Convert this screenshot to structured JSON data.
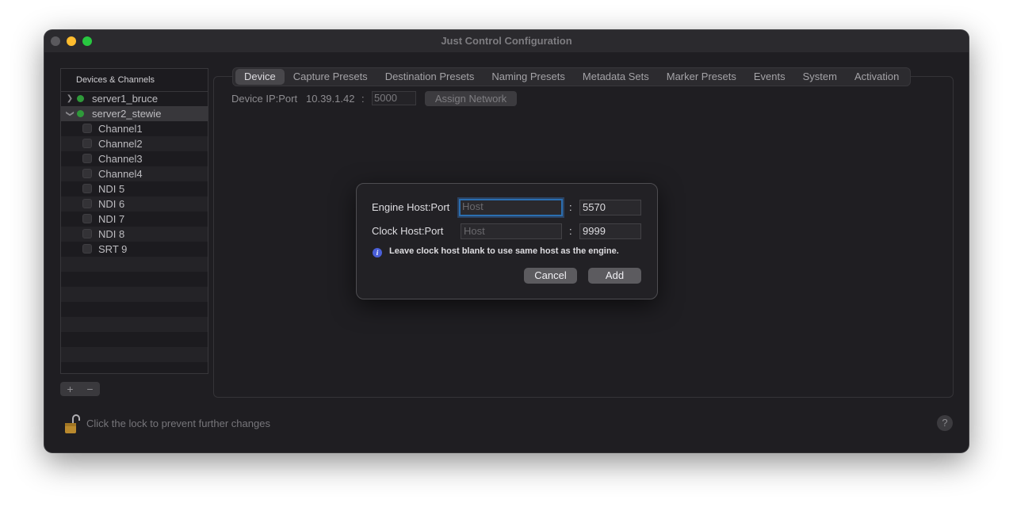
{
  "window": {
    "title": "Just Control Configuration"
  },
  "sidebar": {
    "header": "Devices & Channels",
    "devices": [
      {
        "name": "server1_bruce",
        "expanded": false,
        "status": "online",
        "channels": []
      },
      {
        "name": "server2_stewie",
        "expanded": true,
        "status": "online",
        "channels": [
          "Channel1",
          "Channel2",
          "Channel3",
          "Channel4",
          "NDI 5",
          "NDI 6",
          "NDI 7",
          "NDI 8",
          "SRT 9"
        ]
      }
    ],
    "add_label": "+",
    "remove_label": "−"
  },
  "tabs": [
    "Device",
    "Capture Presets",
    "Destination Presets",
    "Naming Presets",
    "Metadata Sets",
    "Marker Presets",
    "Events",
    "System",
    "Activation"
  ],
  "active_tab": "Device",
  "device": {
    "ip_label": "Device IP:Port",
    "ip": "10.39.1.42",
    "separator": ":",
    "port": "5000",
    "assign_button": "Assign Network"
  },
  "dialog": {
    "engine_label": "Engine Host:Port",
    "engine_host_placeholder": "Host",
    "engine_port": "5570",
    "clock_label": "Clock Host:Port",
    "clock_host_placeholder": "Host",
    "clock_port": "9999",
    "colon": ":",
    "info_text": "Leave clock host blank to use same host as the engine.",
    "cancel": "Cancel",
    "add": "Add"
  },
  "footer": {
    "lock_text": "Click the lock to prevent further changes",
    "help": "?"
  },
  "colors": {
    "status_online": "#2f9a3a",
    "focus": "#2b6eb0",
    "info": "#4a5fd8"
  }
}
